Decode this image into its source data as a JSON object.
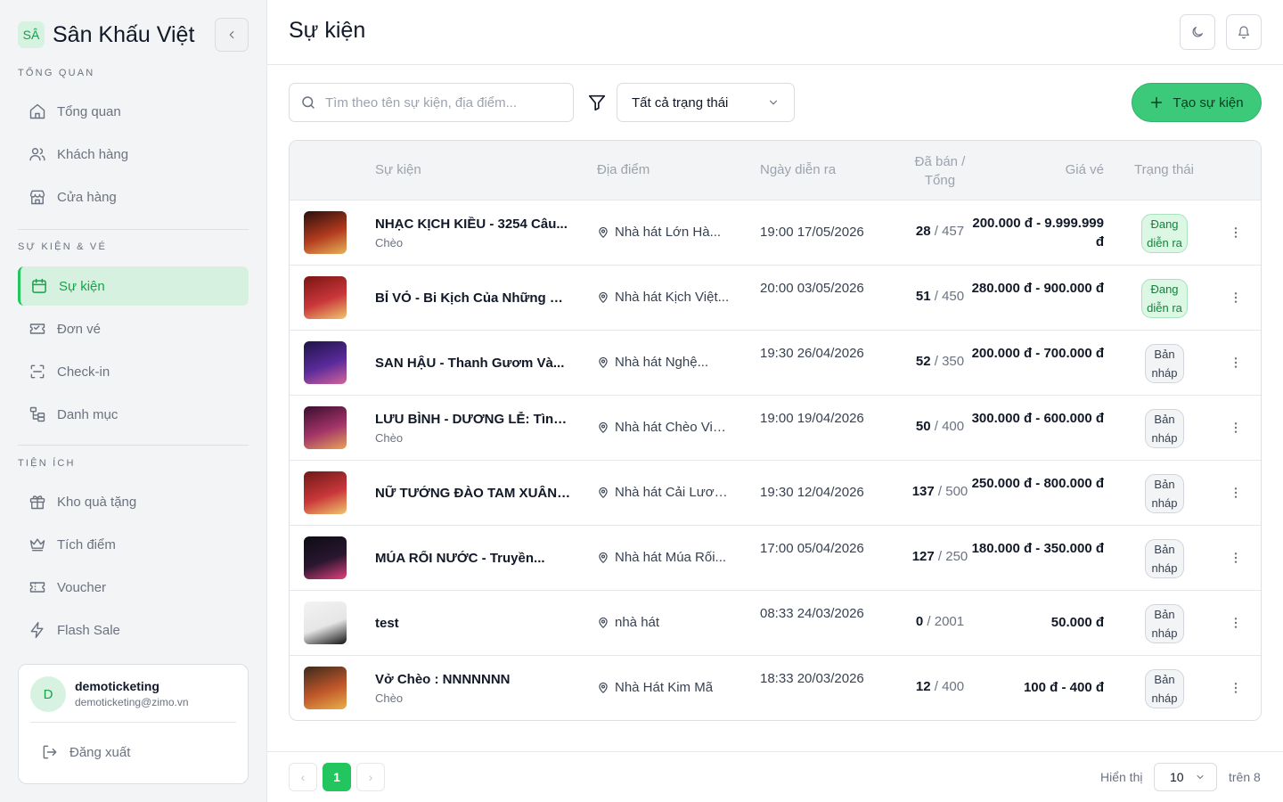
{
  "brand": {
    "logo_text": "SÂ",
    "name": "Sân Khấu Việt"
  },
  "sidebar": {
    "sections": [
      {
        "title": "TỔNG QUAN",
        "items": [
          {
            "label": "Tổng quan",
            "icon": "home-icon"
          },
          {
            "label": "Khách hàng",
            "icon": "users-icon"
          },
          {
            "label": "Cửa hàng",
            "icon": "store-icon"
          }
        ]
      },
      {
        "title": "SỰ KIỆN & VÉ",
        "items": [
          {
            "label": "Sự kiện",
            "icon": "calendar-icon",
            "active": true
          },
          {
            "label": "Đơn vé",
            "icon": "ticket-icon"
          },
          {
            "label": "Check-in",
            "icon": "scan-icon"
          },
          {
            "label": "Danh mục",
            "icon": "category-icon"
          }
        ]
      },
      {
        "title": "TIỆN ÍCH",
        "items": [
          {
            "label": "Kho quà tặng",
            "icon": "gift-icon"
          },
          {
            "label": "Tích điểm",
            "icon": "crown-icon"
          },
          {
            "label": "Voucher",
            "icon": "voucher-icon"
          },
          {
            "label": "Flash Sale",
            "icon": "lightning-icon"
          }
        ]
      }
    ],
    "user": {
      "initial": "D",
      "name": "demoticketing",
      "email": "demoticketing@zimo.vn"
    },
    "logout_label": "Đăng xuất"
  },
  "header": {
    "title": "Sự kiện"
  },
  "toolbar": {
    "search_placeholder": "Tìm theo tên sự kiện, địa điểm...",
    "status_filter": "Tất cả trạng thái",
    "create_label": "Tạo sự kiện"
  },
  "table": {
    "columns": {
      "event": "Sự kiện",
      "venue": "Địa điểm",
      "date": "Ngày diễn ra",
      "sold_line1": "Đã bán /",
      "sold_line2": "Tổng",
      "price": "Giá vé",
      "status": "Trạng thái"
    },
    "rows": [
      {
        "name": "NHẠC KỊCH KIỀU - 3254 Câu...",
        "genre": "Chèo",
        "venue": "Nhà hát Lớn Hà...",
        "date": "19:00 17/05/2026",
        "sold": "28",
        "total": "/ 457",
        "price": "200.000 đ - 9.999.999 đ",
        "status": "Đang diễn ra",
        "status_type": "active",
        "thumb_colors": [
          "#2a0f0c",
          "#b23a1e",
          "#e8b25a"
        ]
      },
      {
        "name": "BỈ VỎ - Bi Kịch Của Những Ki...",
        "genre": "",
        "venue": "Nhà hát Kịch Việt...",
        "date": "20:00 03/05/2026",
        "sold": "51",
        "total": "/ 450",
        "price": "280.000 đ - 900.000 đ",
        "status": "Đang diễn ra",
        "status_type": "active",
        "thumb_colors": [
          "#7a1512",
          "#c9363a",
          "#f0c66e"
        ]
      },
      {
        "name": "SAN HẬU - Thanh Gươm Và...",
        "genre": "",
        "venue": "Nhà hát Nghệ...",
        "date": "19:30 26/04/2026",
        "sold": "52",
        "total": "/ 350",
        "price": "200.000 đ - 700.000 đ",
        "status": "Bản nháp",
        "status_type": "draft",
        "thumb_colors": [
          "#1e1446",
          "#5a2a9b",
          "#d2649b"
        ]
      },
      {
        "name": "LƯU BÌNH - DƯƠNG LỄ: Tình...",
        "genre": "Chèo",
        "venue": "Nhà hát Chèo Việ...",
        "date": "19:00 19/04/2026",
        "sold": "50",
        "total": "/ 400",
        "price": "300.000 đ - 600.000 đ",
        "status": "Bản nháp",
        "status_type": "draft",
        "thumb_colors": [
          "#3a0d2e",
          "#a33468",
          "#e6a35a"
        ]
      },
      {
        "name": "NỮ TƯỚNG ĐÀO TAM XUÂN - ...",
        "genre": "",
        "venue": "Nhà hát Cải Lươn...",
        "date": "19:30 12/04/2026",
        "sold": "137",
        "total": "/ 500",
        "price": "250.000 đ - 800.000 đ",
        "status": "Bản nháp",
        "status_type": "draft",
        "thumb_colors": [
          "#6e1a17",
          "#c9363a",
          "#f2c56b"
        ]
      },
      {
        "name": "MÚA RỐI NƯỚC - Truyền...",
        "genre": "",
        "venue": "Nhà hát Múa Rối...",
        "date": "17:00 05/04/2026",
        "sold": "127",
        "total": "/ 250",
        "price": "180.000 đ - 350.000 đ",
        "status": "Bản nháp",
        "status_type": "draft",
        "thumb_colors": [
          "#0c0c12",
          "#2a1630",
          "#e2407e"
        ]
      },
      {
        "name": "test",
        "genre": "",
        "venue": "nhà hát",
        "date": "08:33 24/03/2026",
        "sold": "0",
        "total": "/ 2001",
        "price": "50.000 đ",
        "status": "Bản nháp",
        "status_type": "draft",
        "thumb_colors": [
          "#f3f3f3",
          "#e6e6e6",
          "#111111"
        ]
      },
      {
        "name": "Vở Chèo : NNNNNNN",
        "genre": "Chèo",
        "venue": "Nhà Hát Kim Mã",
        "date": "18:33 20/03/2026",
        "sold": "12",
        "total": "/ 400",
        "price": "100 đ - 400 đ",
        "status": "Bản nháp",
        "status_type": "draft",
        "thumb_colors": [
          "#3b2a1c",
          "#c0562a",
          "#e8b04a"
        ]
      }
    ]
  },
  "pagination": {
    "prev": "‹",
    "current": "1",
    "next": "›",
    "show_label": "Hiển thị",
    "page_size": "10",
    "total_label": "trên 8"
  }
}
